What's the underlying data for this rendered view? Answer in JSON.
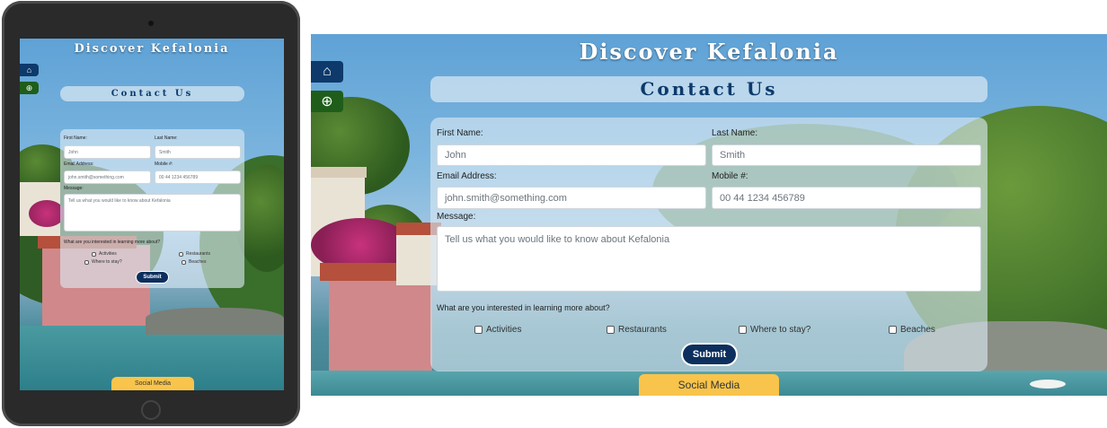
{
  "site": {
    "title": "Discover Kefalonia"
  },
  "nav": {
    "home_icon": "home-icon",
    "zoom_icon": "zoom-in-icon"
  },
  "contact": {
    "heading": "Contact Us",
    "first_name_label": "First Name:",
    "first_name_placeholder": "John",
    "last_name_label": "Last Name:",
    "last_name_placeholder": "Smith",
    "email_label": "Email Address:",
    "email_placeholder": "john.smith@something.com",
    "mobile_label": "Mobile #:",
    "mobile_placeholder": "00 44 1234 456789",
    "message_label": "Message:",
    "message_placeholder": "Tell us what you would like to know about Kefalonia",
    "interests_question": "What are you interested in learning more about?",
    "interests": [
      "Activities",
      "Restaurants",
      "Where to stay?",
      "Beaches"
    ],
    "submit_label": "Submit"
  },
  "footer": {
    "social_label": "Social Media"
  },
  "colors": {
    "primary": "#0d3a6b",
    "zoom": "#1f5e1a",
    "accent": "#f9c44b"
  }
}
